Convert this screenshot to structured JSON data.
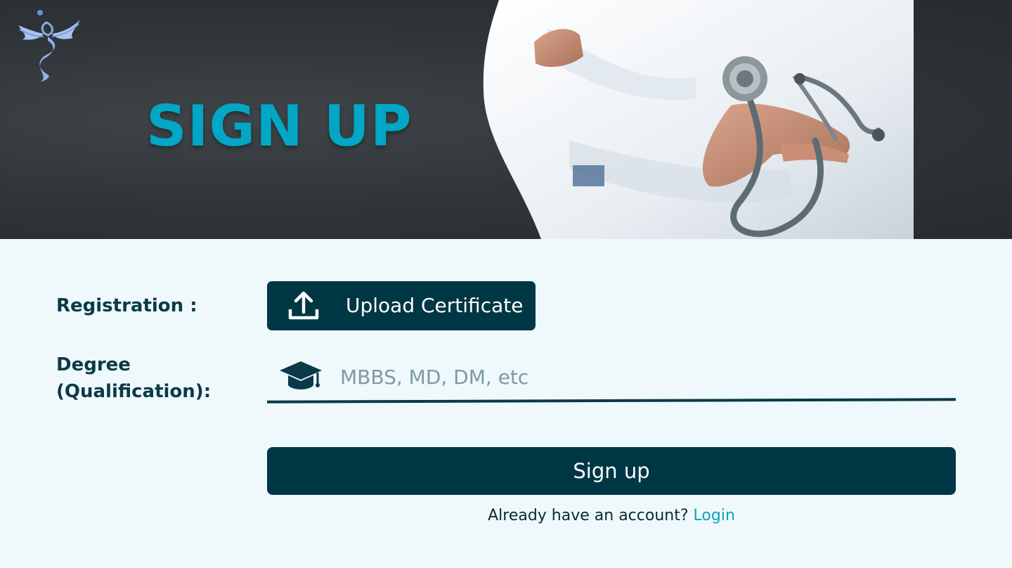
{
  "header": {
    "title": "SIGN UP",
    "logo_icon": "caduceus-angel-logo-icon",
    "hero_image": "doctor-with-stethoscope-photo"
  },
  "form": {
    "registration": {
      "label": "Registration :",
      "button_label": "Upload Certificate",
      "button_icon": "upload-icon"
    },
    "degree": {
      "label_line1": "Degree",
      "label_line2": "(Qualification):",
      "placeholder": "MBBS, MD, DM, etc",
      "value": "",
      "icon": "graduation-cap-icon"
    },
    "submit_label": "Sign up",
    "login_prompt": "Already have an account?",
    "login_link": "Login"
  },
  "colors": {
    "primary": "#003745",
    "accent": "#02a7c6",
    "background": "#eff8fb",
    "hero_bg": "#2f3438"
  }
}
